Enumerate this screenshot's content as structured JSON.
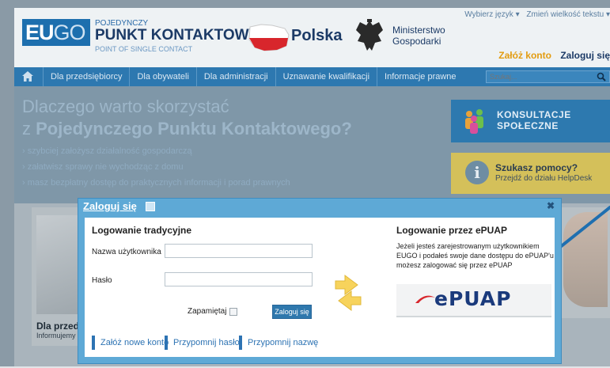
{
  "header": {
    "logo": {
      "eu": "EU",
      "go": "GO"
    },
    "pk_small": "POJEDYNCZY",
    "pk_big": "PUNKT KONTAKTOWY",
    "pk_en": "POINT OF SINGLE CONTACT",
    "country": "Polska",
    "ministry_line1": "Ministerstwo",
    "ministry_line2": "Gospodarki",
    "language_link": "Wybierz język ▾",
    "textsize_link": "Zmień wielkość tekstu ▾",
    "register_link": "Załóż konto",
    "login_link": "Zaloguj się"
  },
  "nav": {
    "items": [
      "Dla przedsiębiorcy",
      "Dla obywateli",
      "Dla administracji",
      "Uznawanie kwalifikacji",
      "Informacje prawne"
    ],
    "search_placeholder": "Szukaj..."
  },
  "hero": {
    "title_line1": "Dlaczego warto skorzystać",
    "title_line2_prefix": "z ",
    "title_line2_strong": "Pojedynczego Punktu Kontaktowego?",
    "bullets": [
      "szybciej założysz działalność gospodarczą",
      "załatwisz sprawy nie wychodząc z domu",
      "masz bezpłatny dostęp do praktycznych informacji i porad prawnych"
    ],
    "consult_line1": "KONSULTACJE",
    "consult_line2": "SPOŁECZNE",
    "help_title": "Szukasz pomocy?",
    "help_sub": "Przejdź do działu HelpDesk"
  },
  "cards": {
    "left_title": "Dla przed",
    "left_sub": "Informujemy"
  },
  "modal": {
    "title": "Zaloguj się",
    "traditional_title": "Logowanie tradycyjne",
    "username_label": "Nazwa użytkownika",
    "username_value": "",
    "password_label": "Hasło",
    "password_value": "",
    "remember_label": "Zapamiętaj",
    "login_button": "Zaloguj się",
    "bottom_links": [
      "Załóż nowe konto",
      "Przypomnij hasło",
      "Przypomnij nazwę"
    ],
    "epuap_title": "Logowanie przez ePUAP",
    "epuap_desc": "Jeżeli jesteś zarejestrowanym użytkownikiem EUGO i podałeś swoje dane dostępu do ePUAP'u możesz zalogować się przez ePUAP",
    "epuap_logo": "ePUAP"
  },
  "colors": {
    "accent": "#2d78b0",
    "orange": "#e39c10",
    "modal_frame": "#5ea9d6",
    "epuap_red": "#d8262c"
  }
}
